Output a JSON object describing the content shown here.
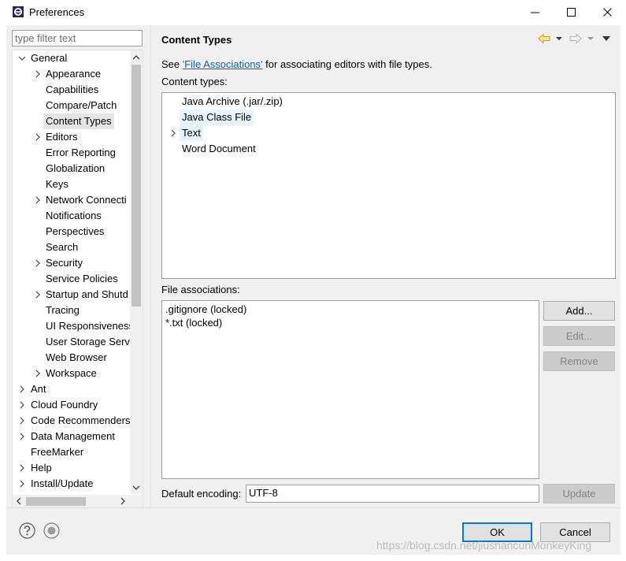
{
  "window": {
    "title": "Preferences",
    "icon": "eclipse-icon"
  },
  "filter": {
    "placeholder": "type filter text"
  },
  "tree": {
    "items": [
      {
        "label": "General",
        "expanded": true,
        "has_children": true
      },
      {
        "label": "Appearance",
        "has_children": true
      },
      {
        "label": "Capabilities"
      },
      {
        "label": "Compare/Patch"
      },
      {
        "label": "Content Types",
        "selected": true
      },
      {
        "label": "Editors",
        "has_children": true
      },
      {
        "label": "Error Reporting"
      },
      {
        "label": "Globalization"
      },
      {
        "label": "Keys"
      },
      {
        "label": "Network Connecti",
        "has_children": true
      },
      {
        "label": "Notifications"
      },
      {
        "label": "Perspectives"
      },
      {
        "label": "Search"
      },
      {
        "label": "Security",
        "has_children": true
      },
      {
        "label": "Service Policies"
      },
      {
        "label": "Startup and Shutd",
        "has_children": true
      },
      {
        "label": "Tracing"
      },
      {
        "label": "UI Responsiveness"
      },
      {
        "label": "User Storage Serv"
      },
      {
        "label": "Web Browser"
      },
      {
        "label": "Workspace",
        "has_children": true
      },
      {
        "label": "Ant",
        "has_children": true
      },
      {
        "label": "Cloud Foundry",
        "has_children": true
      },
      {
        "label": "Code Recommenders",
        "has_children": true
      },
      {
        "label": "Data Management",
        "has_children": true
      },
      {
        "label": "FreeMarker"
      },
      {
        "label": "Help",
        "has_children": true
      },
      {
        "label": "Install/Update",
        "has_children": true
      }
    ]
  },
  "page": {
    "title": "Content Types",
    "see_prefix": "See ",
    "see_link": "'File Associations'",
    "see_suffix": " for associating editors with file types.",
    "content_types_label": "Content types:",
    "content_types": [
      {
        "label": "Java Archive (.jar/.zip)"
      },
      {
        "label": "Java Class File",
        "highlighted": true
      },
      {
        "label": "Text",
        "has_children": true,
        "highlighted": true
      },
      {
        "label": "Word Document"
      }
    ],
    "file_associations_label": "File associations:",
    "file_associations": [
      ".gitignore (locked)",
      "*.txt (locked)"
    ],
    "buttons": {
      "add": "Add...",
      "edit": "Edit...",
      "remove": "Remove",
      "update": "Update"
    },
    "default_encoding_label": "Default encoding:",
    "default_encoding_value": "UTF-8"
  },
  "footer": {
    "ok": "OK",
    "cancel": "Cancel"
  },
  "watermark": "https://blog.csdn.net/jiushancunMonkeyKing",
  "colors": {
    "link": "#0066cc",
    "default_button_border": "#0078d7",
    "nav_arrow": "#e0a000",
    "selection": "#e5e5e5",
    "highlight": "#e5f3ff"
  }
}
